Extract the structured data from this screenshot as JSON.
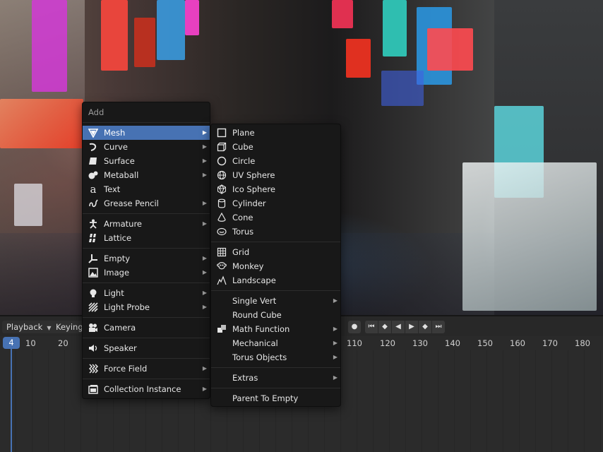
{
  "add_menu": {
    "title": "Add",
    "items": [
      {
        "label": "Mesh",
        "icon": "mesh-icon",
        "submenu": true,
        "active": true
      },
      {
        "label": "Curve",
        "icon": "curve-icon",
        "submenu": true
      },
      {
        "label": "Surface",
        "icon": "surface-icon",
        "submenu": true
      },
      {
        "label": "Metaball",
        "icon": "metaball-icon",
        "submenu": true
      },
      {
        "label": "Text",
        "icon": "text-icon",
        "submenu": false
      },
      {
        "label": "Grease Pencil",
        "icon": "grease-pencil-icon",
        "submenu": true
      },
      {
        "label": "Armature",
        "icon": "armature-icon",
        "submenu": true
      },
      {
        "label": "Lattice",
        "icon": "lattice-icon",
        "submenu": false
      },
      {
        "label": "Empty",
        "icon": "empty-icon",
        "submenu": true
      },
      {
        "label": "Image",
        "icon": "image-icon",
        "submenu": true
      },
      {
        "label": "Light",
        "icon": "light-icon",
        "submenu": true
      },
      {
        "label": "Light Probe",
        "icon": "light-probe-icon",
        "submenu": true
      },
      {
        "label": "Camera",
        "icon": "camera-icon",
        "submenu": false
      },
      {
        "label": "Speaker",
        "icon": "speaker-icon",
        "submenu": false
      },
      {
        "label": "Force Field",
        "icon": "force-field-icon",
        "submenu": true
      },
      {
        "label": "Collection Instance",
        "icon": "collection-instance-icon",
        "submenu": true
      }
    ]
  },
  "mesh_submenu": {
    "items": [
      {
        "label": "Plane",
        "icon": "plane-icon"
      },
      {
        "label": "Cube",
        "icon": "cube-icon"
      },
      {
        "label": "Circle",
        "icon": "circle-icon"
      },
      {
        "label": "UV Sphere",
        "icon": "uv-sphere-icon"
      },
      {
        "label": "Ico Sphere",
        "icon": "ico-sphere-icon"
      },
      {
        "label": "Cylinder",
        "icon": "cylinder-icon"
      },
      {
        "label": "Cone",
        "icon": "cone-icon"
      },
      {
        "label": "Torus",
        "icon": "torus-icon"
      },
      {
        "label": "Grid",
        "icon": "grid-icon"
      },
      {
        "label": "Monkey",
        "icon": "monkey-icon"
      },
      {
        "label": "Landscape",
        "icon": "landscape-icon"
      },
      {
        "label": "Single Vert",
        "submenu": true
      },
      {
        "label": "Round Cube"
      },
      {
        "label": "Math Function",
        "icon": "math-function-icon",
        "submenu": true
      },
      {
        "label": "Mechanical",
        "submenu": true
      },
      {
        "label": "Torus Objects",
        "submenu": true
      },
      {
        "label": "Extras",
        "submenu": true
      },
      {
        "label": "Parent To Empty"
      }
    ]
  },
  "timeline": {
    "playback_label": "Playback",
    "keying_label": "Keying",
    "current_frame": "4",
    "ticks": [
      "10",
      "20",
      "110",
      "120",
      "130",
      "140",
      "150",
      "160",
      "170",
      "180"
    ],
    "transport_icons": [
      "record-icon",
      "jump-start-icon",
      "prev-keyframe-icon",
      "play-reverse-icon",
      "play-icon",
      "next-keyframe-icon",
      "jump-end-icon"
    ],
    "accent_color": "#4772b3"
  }
}
